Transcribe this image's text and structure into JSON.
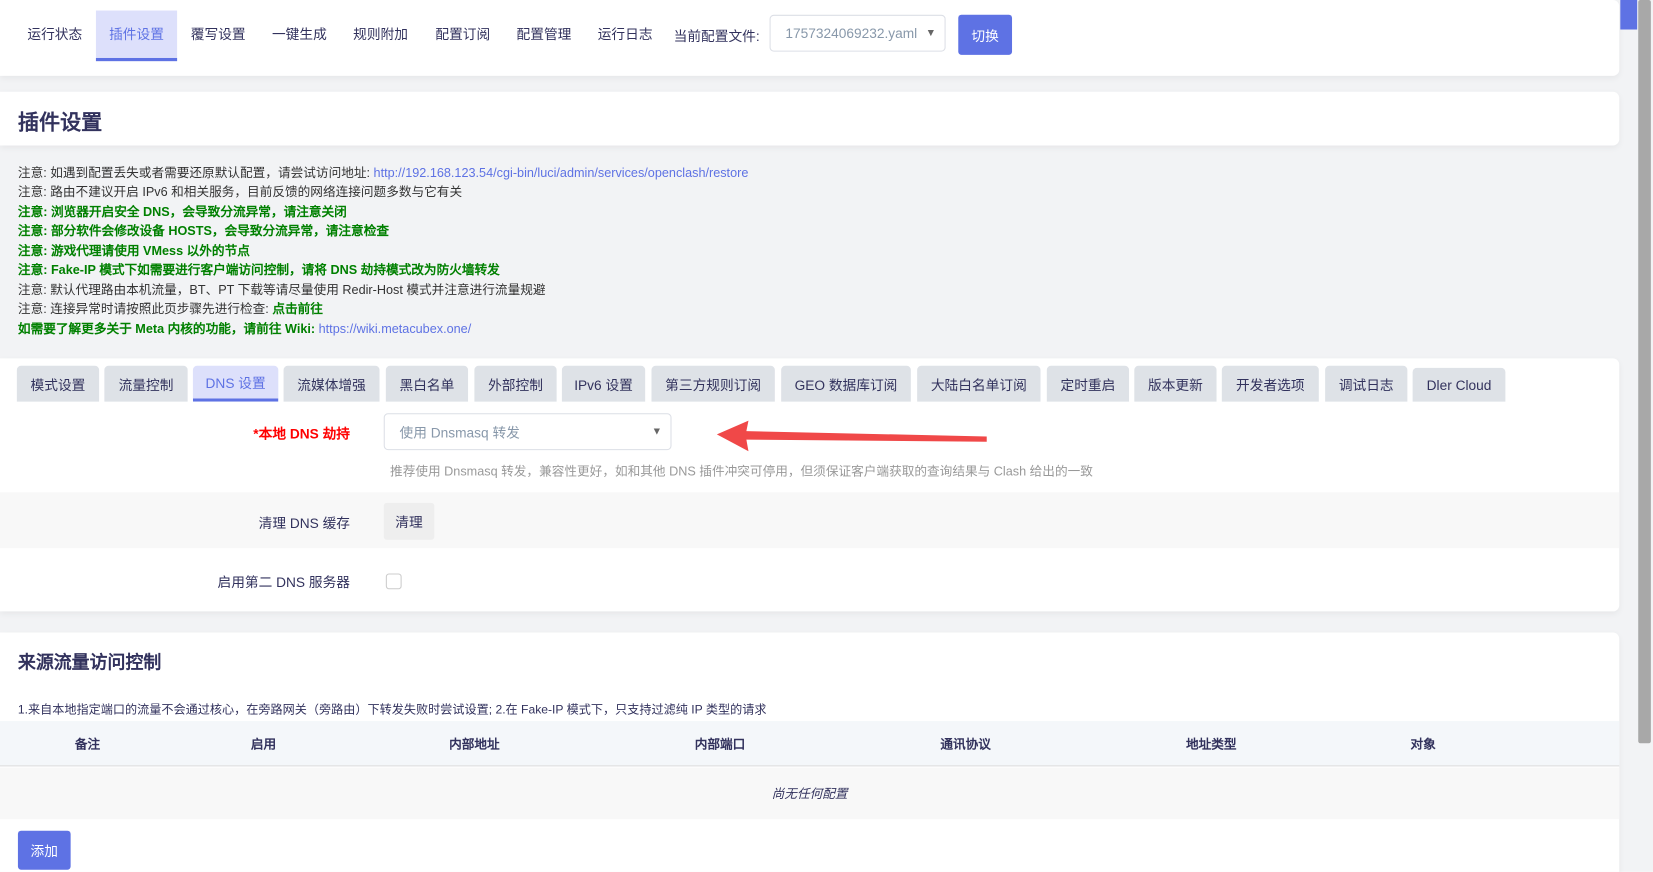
{
  "nav": {
    "items": [
      "运行状态",
      "插件设置",
      "覆写设置",
      "一键生成",
      "规则附加",
      "配置订阅",
      "配置管理",
      "运行日志"
    ],
    "config_label": "当前配置文件:",
    "config_value": "1757324069232.yaml",
    "switch_label": "切换"
  },
  "page_title": "插件设置",
  "notes": [
    {
      "text": "注意: 如遇到配置丢失或者需要还原默认配置，请尝试访问地址: ",
      "link": "http://192.168.123.54/cgi-bin/luci/admin/services/openclash/restore"
    },
    {
      "text": "注意: 路由不建议开启 IPv6 和相关服务，目前反馈的网络连接问题多数与它有关"
    },
    {
      "text": "注意: 浏览器开启安全 DNS，会导致分流异常，请注意关闭"
    },
    {
      "text": "注意: 部分软件会修改设备 HOSTS，会导致分流异常，请注意检查"
    },
    {
      "text": "注意: 游戏代理请使用 VMess 以外的节点"
    },
    {
      "text": "注意: Fake-IP 模式下如需要进行客户端访问控制，请将 DNS 劫持模式改为防火墙转发"
    },
    {
      "text": "注意: 默认代理路由本机流量，BT、PT 下载等请尽量使用 Redir-Host 模式并注意进行流量规避"
    },
    {
      "text": "注意: 连接异常时请按照此页步骤先进行检查: ",
      "link": "点击前往"
    },
    {
      "text": "如需要了解更多关于 Meta 内核的功能，请前往 Wiki: ",
      "link": "https://wiki.metacubex.one/"
    }
  ],
  "tabs": [
    "模式设置",
    "流量控制",
    "DNS 设置",
    "流媒体增强",
    "黑白名单",
    "外部控制",
    "IPv6 设置",
    "第三方规则订阅",
    "GEO 数据库订阅",
    "大陆白名单订阅",
    "定时重启",
    "版本更新",
    "开发者选项",
    "调试日志",
    "Dler Cloud"
  ],
  "dns": {
    "hijack_label": "*本地 DNS 劫持",
    "hijack_value": "使用 Dnsmasq 转发",
    "hijack_hint": "推荐使用 Dnsmasq 转发，兼容性更好，如和其他 DNS 插件冲突可停用，但须保证客户端获取的查询结果与 Clash 给出的一致",
    "flush_label": "清理 DNS 缓存",
    "flush_button": "清理",
    "second_label": "启用第二 DNS 服务器",
    "second_checked": false
  },
  "acl": {
    "title": "来源流量访问控制",
    "desc": "1.来自本地指定端口的流量不会通过核心，在旁路网关（旁路由）下转发失败时尝试设置; 2.在 Fake-IP 模式下，只支持过滤纯 IP 类型的请求",
    "columns": [
      "备注",
      "启用",
      "内部地址",
      "内部端口",
      "通讯协议",
      "地址类型",
      "对象"
    ],
    "empty": "尚无任何配置",
    "add_button": "添加"
  },
  "colors": {
    "accent": "#5e72e4",
    "green": "#008000",
    "red": "#ff0000",
    "arrow": "#f04848"
  }
}
